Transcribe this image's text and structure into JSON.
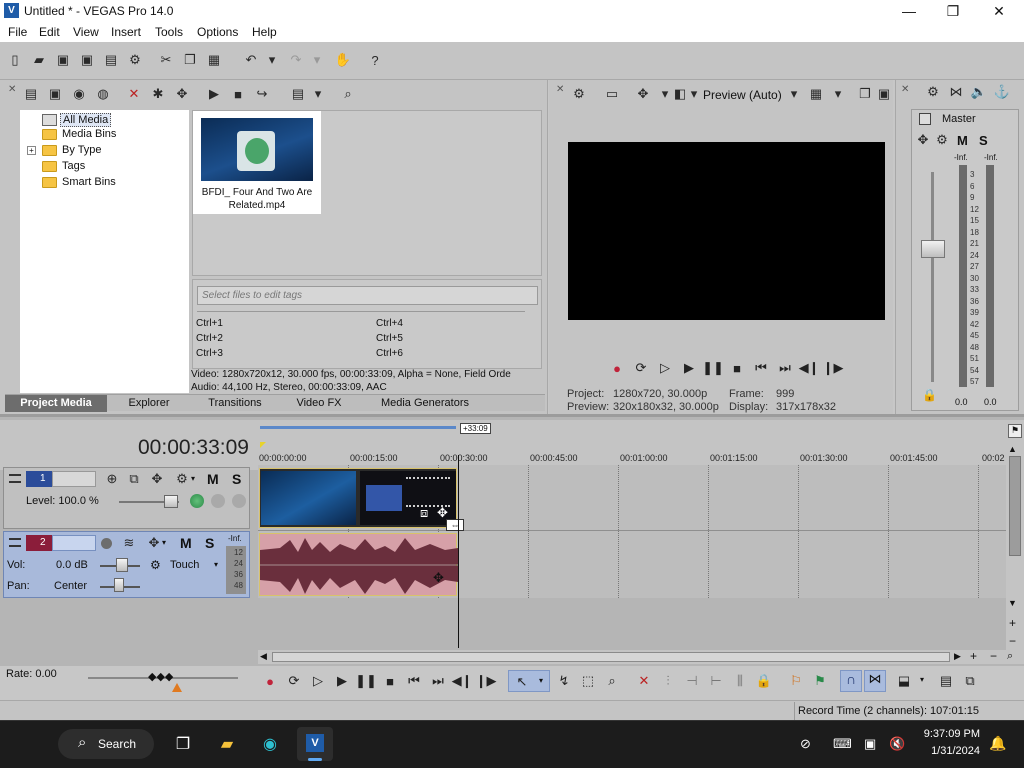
{
  "window": {
    "title": "Untitled * - VEGAS Pro 14.0",
    "minimize": "—",
    "maximize": "❐",
    "close": "✕"
  },
  "menu": [
    "File",
    "Edit",
    "View",
    "Insert",
    "Tools",
    "Options",
    "Help"
  ],
  "media_tree": {
    "items": [
      "All Media",
      "Media Bins",
      "By Type",
      "Tags",
      "Smart Bins"
    ],
    "expand": "+"
  },
  "media_file": {
    "name_line1": "BFDI_ Four And Two Are",
    "name_line2": "Related.mp4"
  },
  "tags": {
    "placeholder": "Select files to edit tags",
    "shortcuts": [
      "Ctrl+1",
      "Ctrl+2",
      "Ctrl+3",
      "Ctrl+4",
      "Ctrl+5",
      "Ctrl+6"
    ]
  },
  "media_info": {
    "video": "Video: 1280x720x12, 30.000 fps, 00:00:33:09, Alpha = None, Field Orde",
    "audio": "Audio: 44,100 Hz, Stereo, 00:00:33:09, AAC"
  },
  "tabs": [
    "Project Media",
    "Explorer",
    "Transitions",
    "Video FX",
    "Media Generators"
  ],
  "preview": {
    "mode": "Preview (Auto)",
    "project_label": "Project:",
    "project_value": "1280x720, 30.000p",
    "preview_label": "Preview:",
    "preview_value": "320x180x32, 30.000p",
    "frame_label": "Frame:",
    "frame_value": "999",
    "display_label": "Display:",
    "display_value": "317x178x32"
  },
  "mixer": {
    "master_label": "Master",
    "m_label": "M",
    "s_label": "S",
    "inf_left": "-Inf.",
    "inf_right": "-Inf.",
    "scale": [
      "3",
      "6",
      "9",
      "12",
      "15",
      "18",
      "21",
      "24",
      "27",
      "30",
      "33",
      "36",
      "39",
      "42",
      "45",
      "48",
      "51",
      "54",
      "57"
    ],
    "bottom_left": "0.0",
    "bottom_right": "0.0"
  },
  "timeline": {
    "timecode": "00:00:33:09",
    "marker": "+33:09",
    "ruler": [
      "00:00:00:00",
      "00:00:15:00",
      "00:00:30:00",
      "00:00:45:00",
      "00:01:00:00",
      "00:01:15:00",
      "00:01:30:00",
      "00:01:45:00",
      "00:02"
    ],
    "video_track": {
      "number": "1",
      "level": "Level: 100.0 %",
      "m": "M",
      "s": "S"
    },
    "audio_track": {
      "number": "2",
      "vol_label": "Vol:",
      "vol_value": "0.0 dB",
      "pan_label": "Pan:",
      "pan_value": "Center",
      "m": "M",
      "s": "S",
      "automation": "Touch",
      "meter_top": "-Inf.",
      "meter_scale": [
        "12",
        "24",
        "36",
        "48"
      ]
    },
    "rate": "Rate: 0.00"
  },
  "status": {
    "record_time": "Record Time (2 channels): 107:01:15"
  },
  "taskbar": {
    "search": "Search",
    "time": "9:37:09 PM",
    "date": "1/31/2024"
  },
  "colors": {
    "accent": "#2f6fd0",
    "track_video": "#2b4c9a",
    "track_audio": "#8b1d3a",
    "audio_event": "#d6a0a8",
    "selection": "#4b6fb8"
  }
}
